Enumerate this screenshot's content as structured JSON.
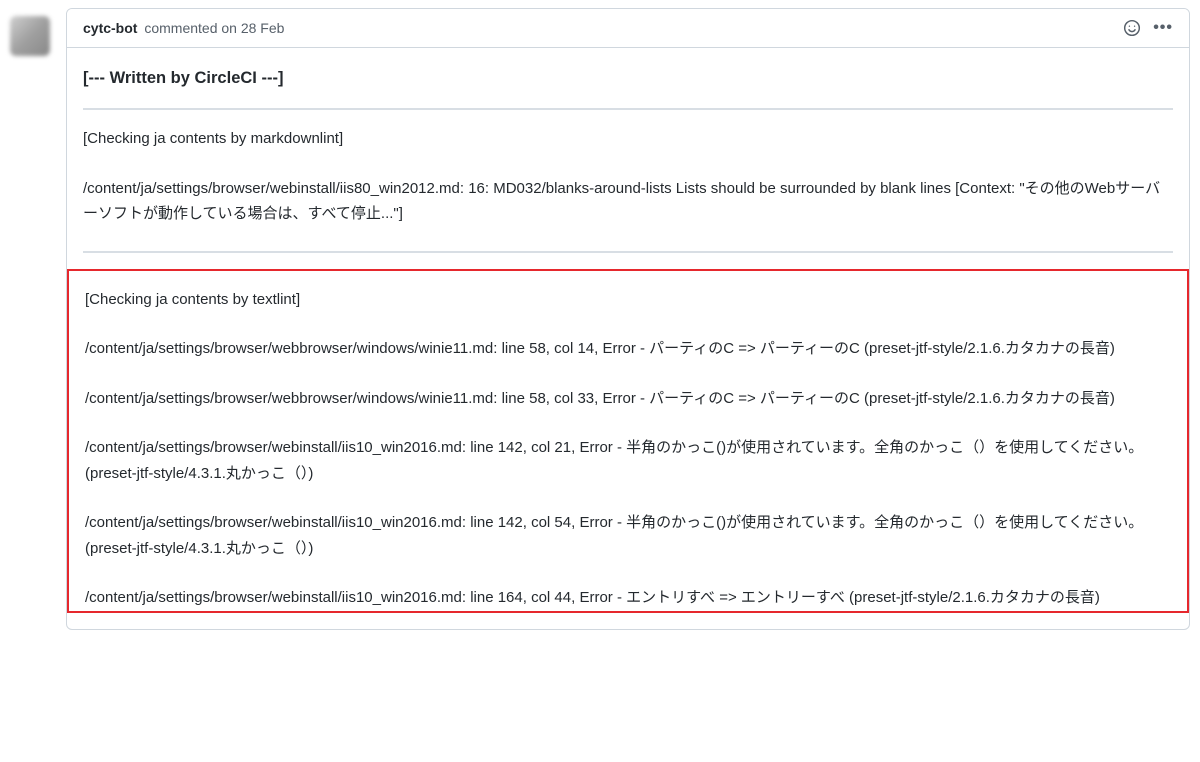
{
  "comment": {
    "author": "cytc-bot",
    "action_text": "commented on 28 Feb",
    "heading": "[--- Written by CircleCI ---]",
    "section1": {
      "label": "[Checking ja contents by markdownlint]",
      "items": [
        "/content/ja/settings/browser/webinstall/iis80_win2012.md: 16: MD032/blanks-around-lists Lists should be surrounded by blank lines [Context: \"その他のWebサーバーソフトが動作している場合は、すべて停止...\"]"
      ]
    },
    "section2": {
      "label": "[Checking ja contents by textlint]",
      "items": [
        "/content/ja/settings/browser/webbrowser/windows/winie11.md: line 58, col 14, Error - パーティのC => パーティーのC (preset-jtf-style/2.1.6.カタカナの長音)",
        "/content/ja/settings/browser/webbrowser/windows/winie11.md: line 58, col 33, Error - パーティのC => パーティーのC (preset-jtf-style/2.1.6.カタカナの長音)",
        "/content/ja/settings/browser/webinstall/iis10_win2016.md: line 142, col 21, Error - 半角のかっこ()が使用されています。全角のかっこ（）を使用してください。 (preset-jtf-style/4.3.1.丸かっこ（）)",
        "/content/ja/settings/browser/webinstall/iis10_win2016.md: line 142, col 54, Error - 半角のかっこ()が使用されています。全角のかっこ（）を使用してください。 (preset-jtf-style/4.3.1.丸かっこ（）)",
        "/content/ja/settings/browser/webinstall/iis10_win2016.md: line 164, col 44, Error - エントリすべ => エントリーすべ (preset-jtf-style/2.1.6.カタカナの長音)"
      ]
    }
  }
}
